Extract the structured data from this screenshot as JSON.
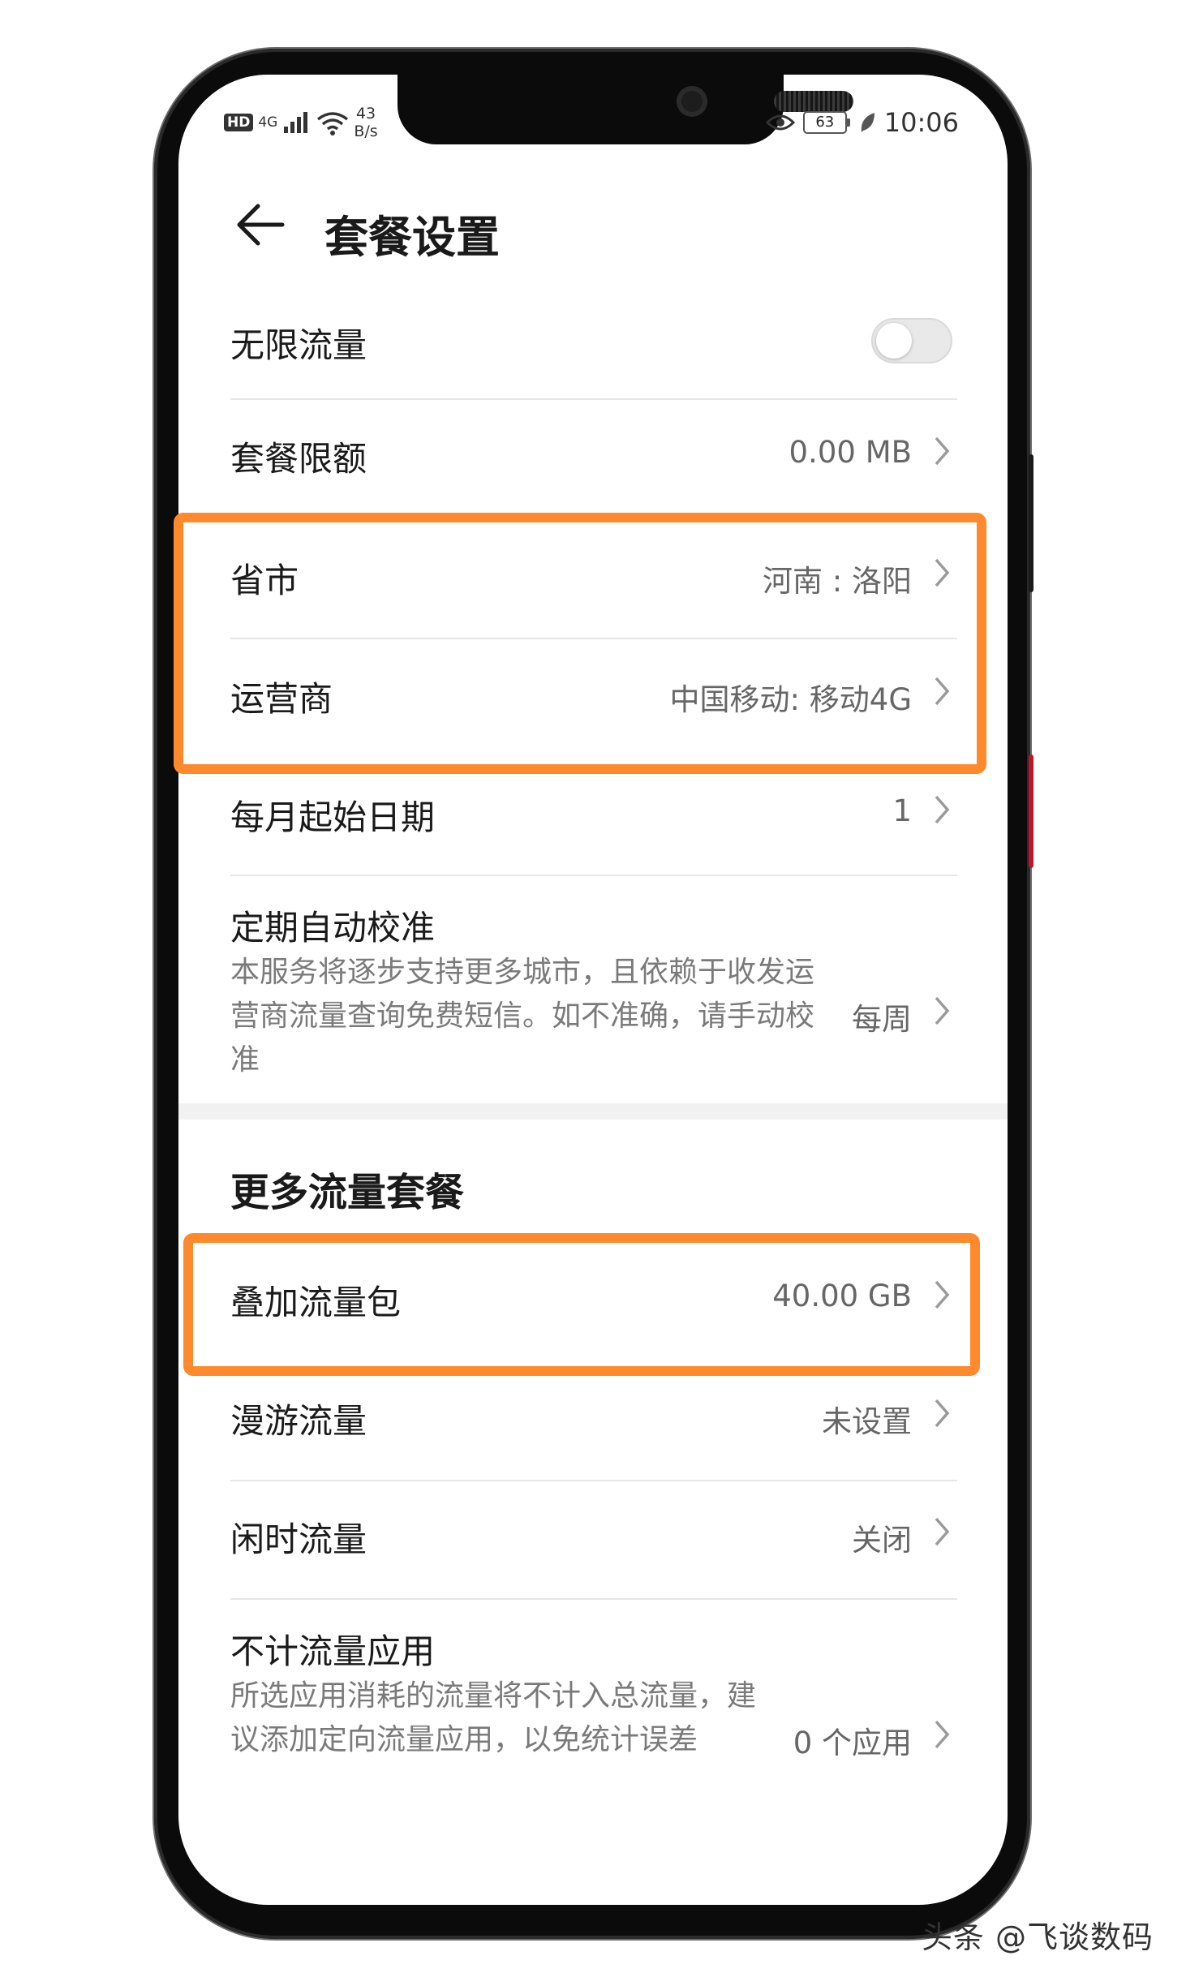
{
  "status_bar": {
    "hd": "HD",
    "network": "4G",
    "net_speed_value": "43",
    "net_speed_unit": "B/s",
    "battery": "63",
    "time": "10:06"
  },
  "header": {
    "title": "套餐设置"
  },
  "rows": {
    "unlimited": {
      "label": "无限流量",
      "toggle_on": false
    },
    "quota": {
      "label": "套餐限额",
      "value": "0.00 MB"
    },
    "province": {
      "label": "省市",
      "value": "河南 : 洛阳"
    },
    "carrier": {
      "label": "运营商",
      "value": "中国移动: 移动4G"
    },
    "start_date": {
      "label": "每月起始日期",
      "value": "1"
    },
    "auto_calibrate": {
      "label": "定期自动校准",
      "desc": "本服务将逐步支持更多城市，且依赖于收发运营商流量查询免费短信。如不准确，请手动校准",
      "value": "每周"
    }
  },
  "more": {
    "title": "更多流量套餐",
    "addon": {
      "label": "叠加流量包",
      "value": "40.00 GB"
    },
    "roaming": {
      "label": "漫游流量",
      "value": "未设置"
    },
    "idle": {
      "label": "闲时流量",
      "value": "关闭"
    },
    "exempt": {
      "label": "不计流量应用",
      "desc": "所选应用消耗的流量将不计入总流量，建议添加定向流量应用，以免统计误差",
      "value": "0 个应用"
    }
  },
  "watermark": "头条 @飞谈数码",
  "colors": {
    "highlight": "#ff8a2e",
    "accent_text": "#666666"
  }
}
